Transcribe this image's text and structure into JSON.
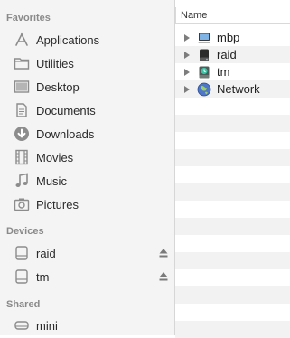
{
  "sidebar": {
    "favorites_title": "Favorites",
    "favorites": [
      {
        "label": "Applications",
        "icon": "applications-icon"
      },
      {
        "label": "Utilities",
        "icon": "folder-icon"
      },
      {
        "label": "Desktop",
        "icon": "desktop-icon"
      },
      {
        "label": "Documents",
        "icon": "documents-icon"
      },
      {
        "label": "Downloads",
        "icon": "downloads-icon"
      },
      {
        "label": "Movies",
        "icon": "movies-icon"
      },
      {
        "label": "Music",
        "icon": "music-icon"
      },
      {
        "label": "Pictures",
        "icon": "pictures-icon"
      }
    ],
    "devices_title": "Devices",
    "devices": [
      {
        "label": "raid",
        "icon": "drive-icon",
        "ejectable": true
      },
      {
        "label": "tm",
        "icon": "drive-icon",
        "ejectable": true
      }
    ],
    "shared_title": "Shared",
    "shared": [
      {
        "label": "mini",
        "icon": "server-icon"
      }
    ]
  },
  "content": {
    "column_name": "Name",
    "rows": [
      {
        "label": "mbp",
        "icon": "computer-icon"
      },
      {
        "label": "raid",
        "icon": "drive-icon"
      },
      {
        "label": "tm",
        "icon": "time-machine-drive-icon"
      },
      {
        "label": "Network",
        "icon": "network-globe-icon"
      }
    ]
  },
  "colors": {
    "sidebar_bg": "#f4f4f4",
    "sidebar_icon": "#8c8c8c",
    "section_title": "#8a8a8a",
    "stripe": "#f2f2f2"
  }
}
